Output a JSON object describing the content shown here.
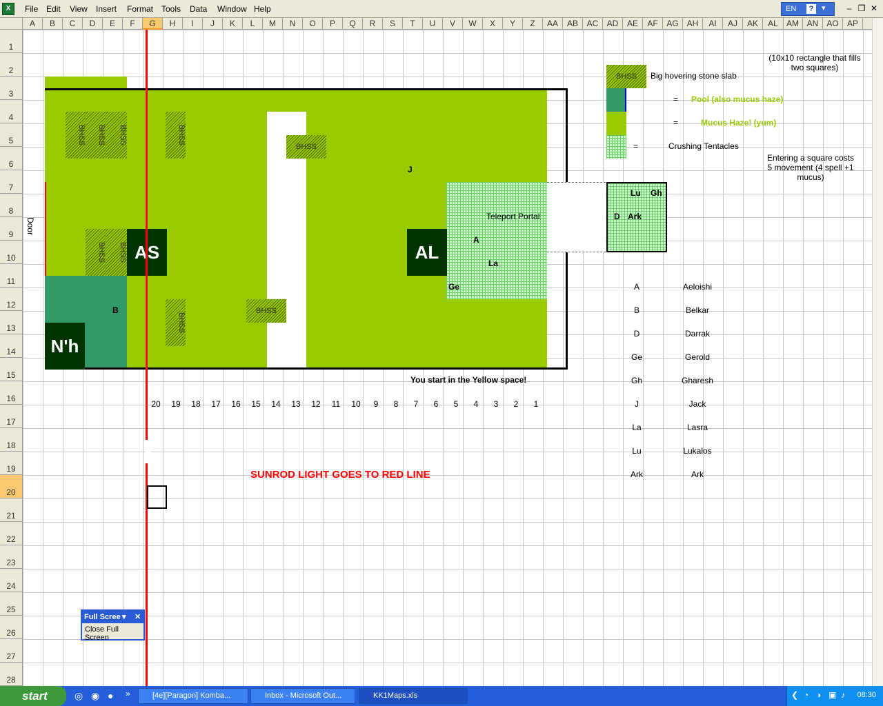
{
  "menu": {
    "items": [
      "File",
      "Edit",
      "View",
      "Insert",
      "Format",
      "Tools",
      "Data",
      "Window",
      "Help"
    ],
    "lang": "EN",
    "help_icon": "?"
  },
  "columns": [
    "A",
    "B",
    "C",
    "D",
    "E",
    "F",
    "G",
    "H",
    "I",
    "J",
    "K",
    "L",
    "M",
    "N",
    "O",
    "P",
    "Q",
    "R",
    "S",
    "T",
    "U",
    "V",
    "W",
    "X",
    "Y",
    "Z",
    "AA",
    "AB",
    "AC",
    "AD",
    "AE",
    "AF",
    "AG",
    "AH",
    "AI",
    "AJ",
    "AK",
    "AL",
    "AM",
    "AN",
    "AO",
    "AP"
  ],
  "rows": [
    "1",
    "2",
    "3",
    "4",
    "5",
    "6",
    "7",
    "8",
    "9",
    "10",
    "11",
    "12",
    "13",
    "14",
    "15",
    "16",
    "17",
    "18",
    "19",
    "20",
    "21",
    "22",
    "23",
    "24",
    "25",
    "26",
    "27",
    "28"
  ],
  "selected_col": "G",
  "selected_row": "20",
  "map": {
    "door": "Door",
    "bhss": "BHSS",
    "as": "AS",
    "al": "AL",
    "nh": "N'h",
    "tokens": {
      "j": "J",
      "a": "A",
      "la": "La",
      "ge": "Ge",
      "b": "B"
    },
    "teleport": "Teleport Portal",
    "start_note": "You start in the Yellow space!",
    "numbers": [
      "20",
      "19",
      "18",
      "17",
      "16",
      "15",
      "14",
      "13",
      "12",
      "11",
      "10",
      "9",
      "8",
      "7",
      "6",
      "5",
      "4",
      "3",
      "2",
      "1"
    ],
    "sunrod": "SUNROD LIGHT GOES TO RED LINE"
  },
  "legend": {
    "rect_note": "(10x10 rectangle that fills two squares)",
    "bhss_label": "BHSS",
    "bhss_desc": "Big hovering stone slab",
    "eq": "=",
    "pool_desc": "Pool (also mucus haze)",
    "mucus_desc": "Mucus Haze! (yum)",
    "tent_desc": "Crushing Tentacles",
    "cost_note": "Entering a square costs 5 movement (4 spell +1 mucus)",
    "inset": {
      "lu": "Lu",
      "gh": "Gh",
      "d": "D",
      "ark": "Ark"
    },
    "keys": [
      {
        "k": "A",
        "v": "Aeloishi"
      },
      {
        "k": "B",
        "v": "Belkar"
      },
      {
        "k": "D",
        "v": "Darrak"
      },
      {
        "k": "Ge",
        "v": "Gerold"
      },
      {
        "k": "Gh",
        "v": "Gharesh"
      },
      {
        "k": "J",
        "v": "Jack"
      },
      {
        "k": "La",
        "v": "Lasra"
      },
      {
        "k": "Lu",
        "v": "Lukalos"
      },
      {
        "k": "Ark",
        "v": "Ark"
      }
    ]
  },
  "fullscreen": {
    "title": "Full Scree",
    "close": "Close Full Screen"
  },
  "taskbar": {
    "start": "start",
    "tasks": [
      "[4e][Paragon] Komba...",
      "Inbox - Microsoft Out...",
      "KK1Maps.xls"
    ],
    "clock": "08:30"
  },
  "colors": {
    "mucus": "#99cc00",
    "pool": "#339966",
    "dark": "#003300",
    "tentacle": "#ccffcc",
    "red": "#ff0000"
  }
}
